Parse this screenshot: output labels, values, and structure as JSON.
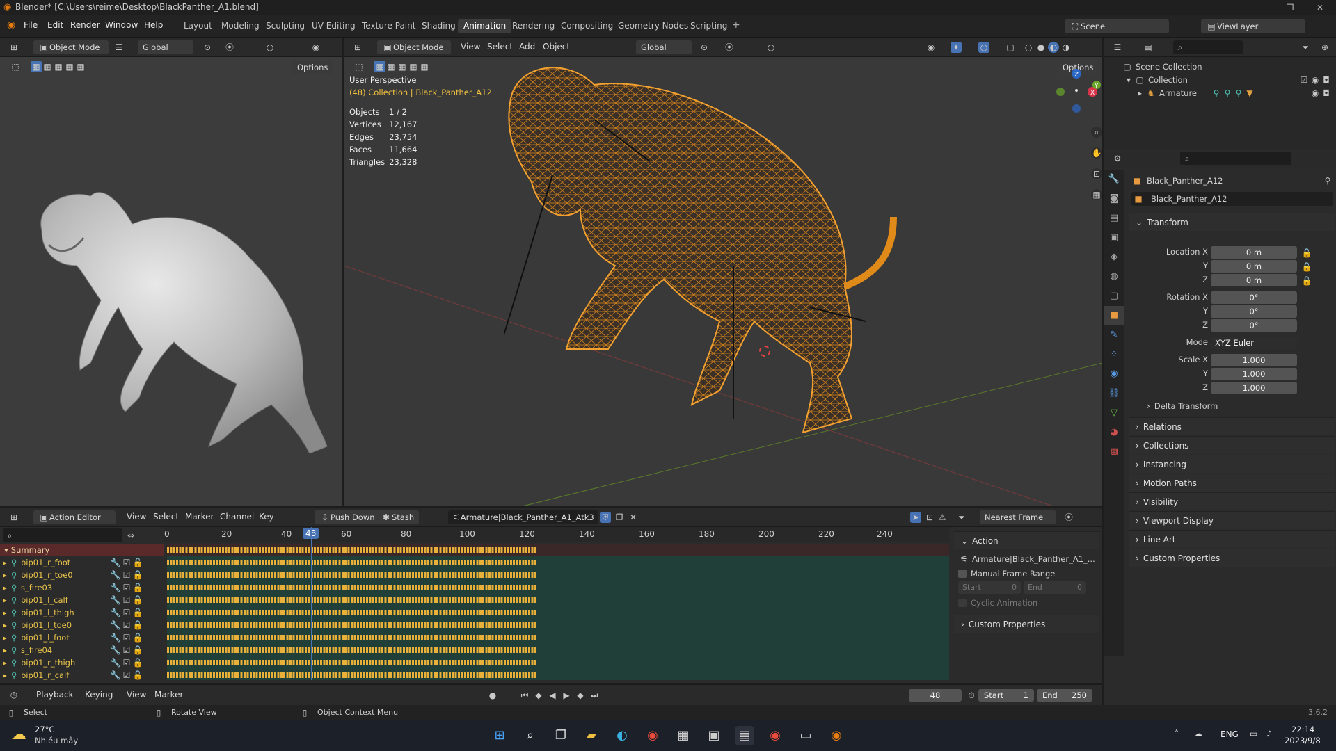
{
  "window": {
    "title": "Blender* [C:\\Users\\reime\\Desktop\\BlackPanther_A1.blend]"
  },
  "menu": [
    "File",
    "Edit",
    "Render",
    "Window",
    "Help"
  ],
  "workspaces": [
    "Layout",
    "Modeling",
    "Sculpting",
    "UV Editing",
    "Texture Paint",
    "Shading",
    "Animation",
    "Rendering",
    "Compositing",
    "Geometry Nodes",
    "Scripting"
  ],
  "active_workspace": "Animation",
  "scene": {
    "name": "Scene",
    "view_layer": "ViewLayer"
  },
  "viewport_left": {
    "mode": "Object Mode",
    "orientation": "Global",
    "options": "Options"
  },
  "viewport_right": {
    "mode": "Object Mode",
    "menus": [
      "View",
      "Select",
      "Add",
      "Object"
    ],
    "orientation": "Global",
    "options": "Options",
    "perspective": "User Perspective",
    "collection_line": "(48) Collection | Black_Panther_A12",
    "stats": [
      [
        "Objects",
        "1 / 2"
      ],
      [
        "Vertices",
        "12,167"
      ],
      [
        "Edges",
        "23,754"
      ],
      [
        "Faces",
        "11,664"
      ],
      [
        "Triangles",
        "23,328"
      ]
    ]
  },
  "outliner": {
    "scene_collection": "Scene Collection",
    "collection": "Collection",
    "armature": "Armature"
  },
  "properties": {
    "object_name": "Black_Panther_A12",
    "object_field": "Black_Panther_A12",
    "transform": "Transform",
    "location_label": "Location X",
    "loc": [
      "0 m",
      "0 m",
      "0 m"
    ],
    "rotation_label": "Rotation X",
    "rot": [
      "0°",
      "0°",
      "0°"
    ],
    "mode_label": "Mode",
    "mode": "XYZ Euler",
    "scale_label": "Scale X",
    "scale": [
      "1.000",
      "1.000",
      "1.000"
    ],
    "y": "Y",
    "z": "Z",
    "delta": "Delta Transform",
    "panels": [
      "Relations",
      "Collections",
      "Instancing",
      "Motion Paths",
      "Visibility",
      "Viewport Display",
      "Line Art",
      "Custom Properties"
    ]
  },
  "action_editor": {
    "mode": "Action Editor",
    "menus": [
      "View",
      "Select",
      "Marker",
      "Channel",
      "Key"
    ],
    "push_down": "Push Down",
    "stash": "Stash",
    "action": "Armature|Black_Panther_A1_Atk3",
    "snap": "Nearest Frame",
    "ruler": [
      "0",
      "20",
      "40",
      "48",
      "60",
      "80",
      "100",
      "120",
      "140",
      "160",
      "180",
      "200",
      "220",
      "240"
    ],
    "current_frame": "48",
    "summary": "Summary",
    "channels": [
      "bip01_r_foot",
      "bip01_r_toe0",
      "s_fire03",
      "bip01_l_calf",
      "bip01_l_thigh",
      "bip01_l_toe0",
      "bip01_l_foot",
      "s_fire04",
      "bip01_r_thigh",
      "bip01_r_calf"
    ],
    "side_panel": {
      "header": "Action",
      "action_name": "Armature|Black_Panther_A1_...",
      "manual_range": "Manual Frame Range",
      "start_label": "Start",
      "start": "0",
      "end_label": "End",
      "end": "0",
      "cyclic": "Cyclic Animation",
      "custom_props": "Custom Properties"
    }
  },
  "timeline": {
    "menus": [
      "Playback",
      "Keying",
      "View",
      "Marker"
    ],
    "frame": "48",
    "start_label": "Start",
    "start": "1",
    "end_label": "End",
    "end": "250"
  },
  "status": {
    "select": "Select",
    "rotate": "Rotate View",
    "context": "Object Context Menu",
    "version": "3.6.2"
  },
  "taskbar": {
    "temp": "27°C",
    "weather": "Nhiều mây",
    "lang": "ENG",
    "time": "22:14",
    "date": "2023/9/8"
  },
  "colors": {
    "accent_blue": "#4772b3",
    "keyframe": "#e9b13a",
    "track_bg": "#1f3f38",
    "wire": "#e08a1a"
  }
}
